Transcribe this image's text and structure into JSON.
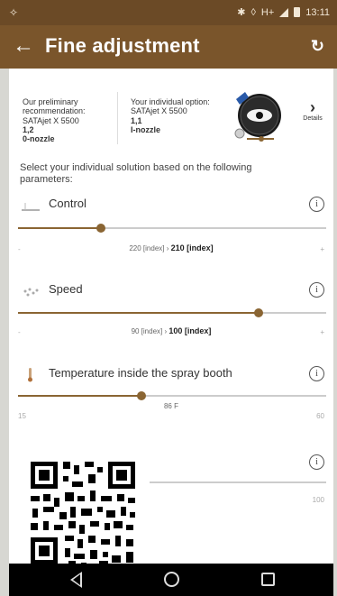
{
  "status_bar": {
    "time": "13:11",
    "left_icon": "satellite-icon",
    "network_label": "H+",
    "icons": [
      "bluetooth-icon",
      "vibrate-icon",
      "signal-icon",
      "battery-icon"
    ]
  },
  "app_bar": {
    "title": "Fine adjustment",
    "back_icon": "arrow-left-icon",
    "refresh_icon": "refresh-icon"
  },
  "recommendation": {
    "preliminary": {
      "caption": "Our preliminary recommendation:",
      "model": "SATAjet X 5500",
      "size": "1,2",
      "nozzle": "0-nozzle"
    },
    "individual": {
      "caption": "Your individual option:",
      "model": "SATAjet X 5500",
      "size": "1,1",
      "nozzle": "I-nozzle"
    },
    "details_label": "Details",
    "details_icon": "chevron-right-icon"
  },
  "select_text": "Select your individual solution based on the following parameters:",
  "parameters": [
    {
      "label": "Control",
      "icon": "control-icon",
      "slider_fraction": 0.27,
      "min": "-",
      "max": "+",
      "value_text": "220 [index]",
      "arrow": "›",
      "value_bold": "210 [index]"
    },
    {
      "label": "Speed",
      "icon": "speed-icon",
      "slider_fraction": 0.78,
      "min": "-",
      "max": "+",
      "value_text": "90 [index]",
      "arrow": "›",
      "value_bold": "100 [index]"
    },
    {
      "label": "Temperature inside the spray booth",
      "icon": "thermometer-icon",
      "slider_fraction": 0.4,
      "min": "15",
      "max": "60",
      "value_text": "86 F",
      "arrow": "",
      "value_bold": ""
    },
    {
      "label": "",
      "icon": "humidity-icon",
      "slider_fraction": 0.0,
      "min": "",
      "max": "100",
      "value_text": "",
      "arrow": "",
      "value_bold": ""
    }
  ],
  "info_icon": "info-icon",
  "nav": {
    "back_icon": "nav-back-icon",
    "home_icon": "nav-home-icon",
    "recent_icon": "nav-recent-icon"
  },
  "colors": {
    "app_bar": "#7a552b",
    "status_bar": "#6b4a26",
    "slider": "#8a6533",
    "background": "#d7d7d2"
  }
}
